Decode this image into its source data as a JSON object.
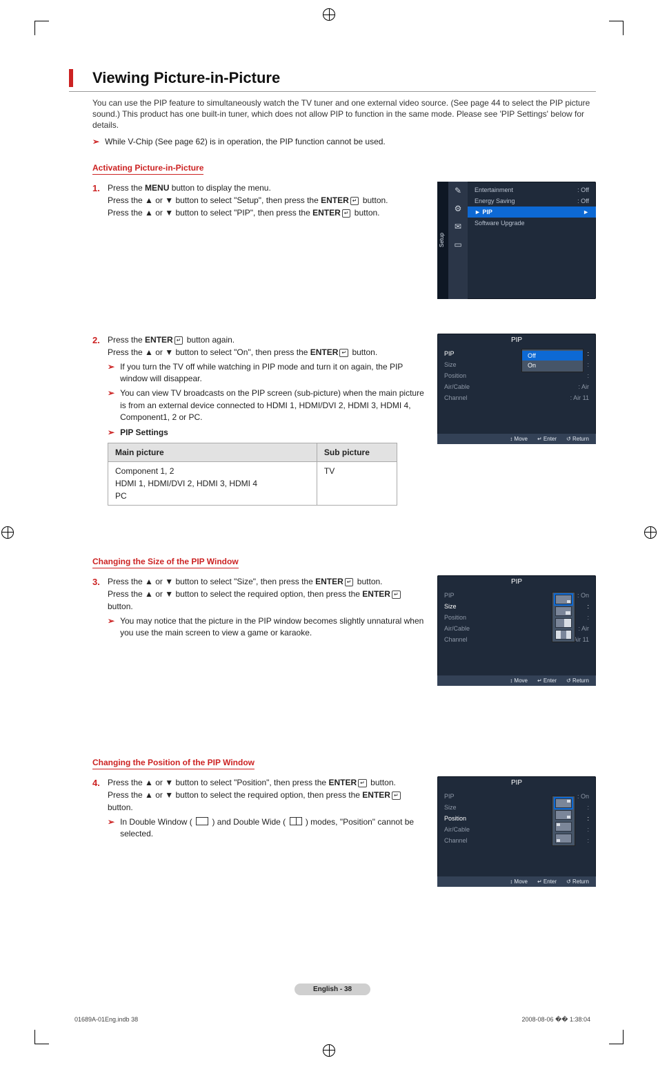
{
  "heading": "Viewing Picture-in-Picture",
  "intro": "You can use the PIP feature to simultaneously watch the TV tuner and one external video source. (See page 44 to select the PIP picture sound.) This product has one built-in tuner, which does not allow PIP to function in the same mode. Please see 'PIP Settings' below for details.",
  "top_note": "While V-Chip (See page 62) is in operation, the PIP function cannot be used.",
  "section_activate": "Activating Picture-in-Picture",
  "step1_a": "Press the ",
  "step1_menu": "MENU",
  "step1_b": " button to display the menu.",
  "step1_c": "Press the ▲ or ▼ button to select \"Setup\", then press the ",
  "step1_enter": "ENTER",
  "step1_d": " button.",
  "step1_e": "Press the ▲ or ▼ button to select \"PIP\", then press the ",
  "step1_f": " button.",
  "step2_a": "Press the ",
  "step2_b": " button again.",
  "step2_c": "Press the ▲ or ▼ button to select \"On\", then press the ",
  "step2_d": " button.",
  "step2_note1": "If you turn the TV off while watching in PIP mode and turn it on again, the PIP window will disappear.",
  "step2_note2": "You can view TV broadcasts on the PIP screen (sub-picture) when the main picture is from an external device connected to HDMI 1, HDMI/DVI 2, HDMI 3, HDMI 4, Component1, 2 or PC.",
  "pip_settings_label": "PIP Settings",
  "table": {
    "h1": "Main picture",
    "h2": "Sub picture",
    "c1a": "Component 1, 2",
    "c1b": "HDMI 1, HDMI/DVI 2, HDMI 3, HDMI 4",
    "c1c": "PC",
    "c2": "TV"
  },
  "section_size": "Changing the Size of the PIP Window",
  "step3_a": "Press the ▲ or ▼ button to select \"Size\", then press the ",
  "step3_b": " button.",
  "step3_c": "Press the ▲ or ▼ button to select the required option, then press the ",
  "step3_d": " button.",
  "step3_note": "You may notice that the picture in the PIP window becomes slightly unnatural when you use the main screen to view a game or karaoke.",
  "section_pos": "Changing the Position of the PIP Window",
  "step4_a": "Press the ▲ or ▼ button to select \"Position\", then press the ",
  "step4_b": " button.",
  "step4_c": "Press the ▲ or ▼ button to select the required option, then press the ",
  "step4_d": " button.",
  "step4_note_a": "In Double Window ( ",
  "step4_note_b": " ) and Double Wide ( ",
  "step4_note_c": " ) modes, \"Position\" cannot be selected.",
  "osd": {
    "setup_label": "Setup",
    "entertainment": "Entertainment",
    "energy": "Energy Saving",
    "pip": "PIP",
    "upgrade": "Software Upgrade",
    "off": ": Off",
    "caret": "►",
    "pip_title": "PIP",
    "lbl_pip": "PIP",
    "lbl_size": "Size",
    "lbl_position": "Position",
    "lbl_aircable": "Air/Cable",
    "lbl_channel": "Channel",
    "val_on": ": On",
    "val_air": ": Air",
    "val_air11": ": Air 11",
    "val_colon": ":",
    "opt_off": "Off",
    "opt_on": "On",
    "foot_move": "Move",
    "foot_enter": "Enter",
    "foot_return": "Return",
    "updown": "↕",
    "enter_sym": "↵",
    "return_sym": "↺"
  },
  "page_num": "English - 38",
  "footer_left": "01689A-01Eng.indb   38",
  "footer_right": "2008-08-06   �� 1:38:04"
}
